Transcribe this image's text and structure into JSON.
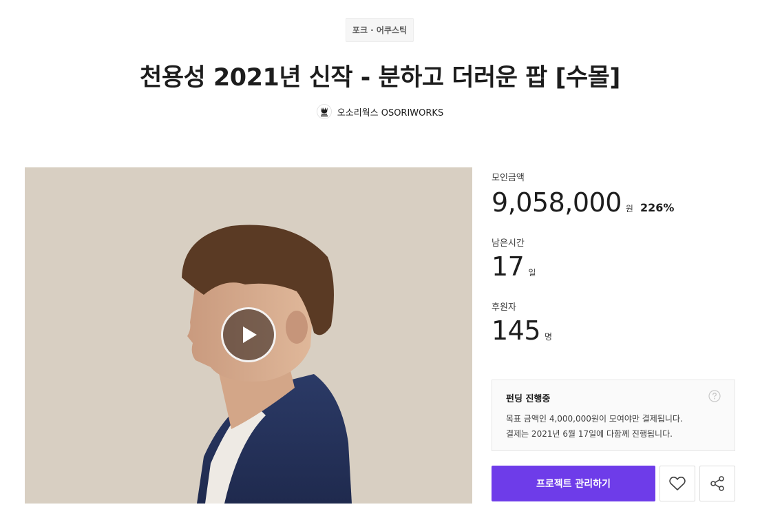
{
  "category": "포크 · 어쿠스틱",
  "title": "천용성 2021년 신작 - 분하고 더러운 팝 [수몰]",
  "creator": {
    "name": "오소리웍스 OSORIWORKS",
    "logo_icon": "badger-logo-icon"
  },
  "media": {
    "play_icon": "play-icon"
  },
  "stats": {
    "raised": {
      "label": "모인금액",
      "value": "9,058,000",
      "unit": "원",
      "percent": "226%"
    },
    "remaining": {
      "label": "남은시간",
      "value": "17",
      "unit": "일"
    },
    "backers": {
      "label": "후원자",
      "value": "145",
      "unit": "명"
    }
  },
  "notice": {
    "title": "펀딩 진행중",
    "line1": "목표 금액인 4,000,000원이 모여야만 결제됩니다.",
    "line2": "결제는 2021년 6월 17일에 다함께 진행됩니다.",
    "help_icon": "question-icon"
  },
  "actions": {
    "manage_label": "프로젝트 관리하기",
    "like_icon": "heart-icon",
    "share_icon": "share-icon",
    "accent_color": "#6e3ce9"
  }
}
